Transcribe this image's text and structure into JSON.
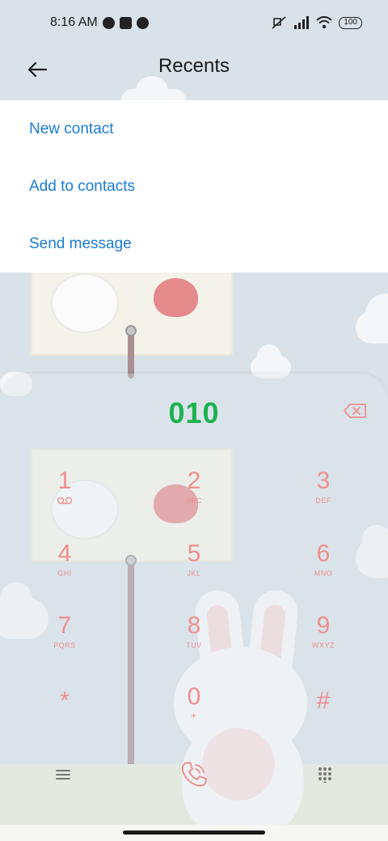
{
  "status_bar": {
    "time": "8:16 AM",
    "battery": "100",
    "icons": [
      "notification-icon",
      "square-icon",
      "notification-icon",
      "mute-icon",
      "signal-icon",
      "wifi-icon",
      "battery-icon"
    ]
  },
  "header": {
    "title": "Recents",
    "back_icon": "arrow-left-icon"
  },
  "menu": {
    "items": [
      {
        "label": "New contact"
      },
      {
        "label": "Add to contacts"
      },
      {
        "label": "Send message"
      }
    ]
  },
  "dialer": {
    "number": "010",
    "keys": [
      {
        "digit": "1",
        "letters": ""
      },
      {
        "digit": "2",
        "letters": "ABC"
      },
      {
        "digit": "3",
        "letters": "DEF"
      },
      {
        "digit": "4",
        "letters": "GHI"
      },
      {
        "digit": "5",
        "letters": "JKL"
      },
      {
        "digit": "6",
        "letters": "MNO"
      },
      {
        "digit": "7",
        "letters": "PQRS"
      },
      {
        "digit": "8",
        "letters": "TUV"
      },
      {
        "digit": "9",
        "letters": "WXYZ"
      },
      {
        "digit": "*",
        "letters": ""
      },
      {
        "digit": "0",
        "letters": "+"
      },
      {
        "digit": "#",
        "letters": ""
      }
    ]
  },
  "colors": {
    "accent_blue": "#1a7bd6",
    "number_green": "#1bb24f",
    "key_pink": "#ef8f8f"
  }
}
